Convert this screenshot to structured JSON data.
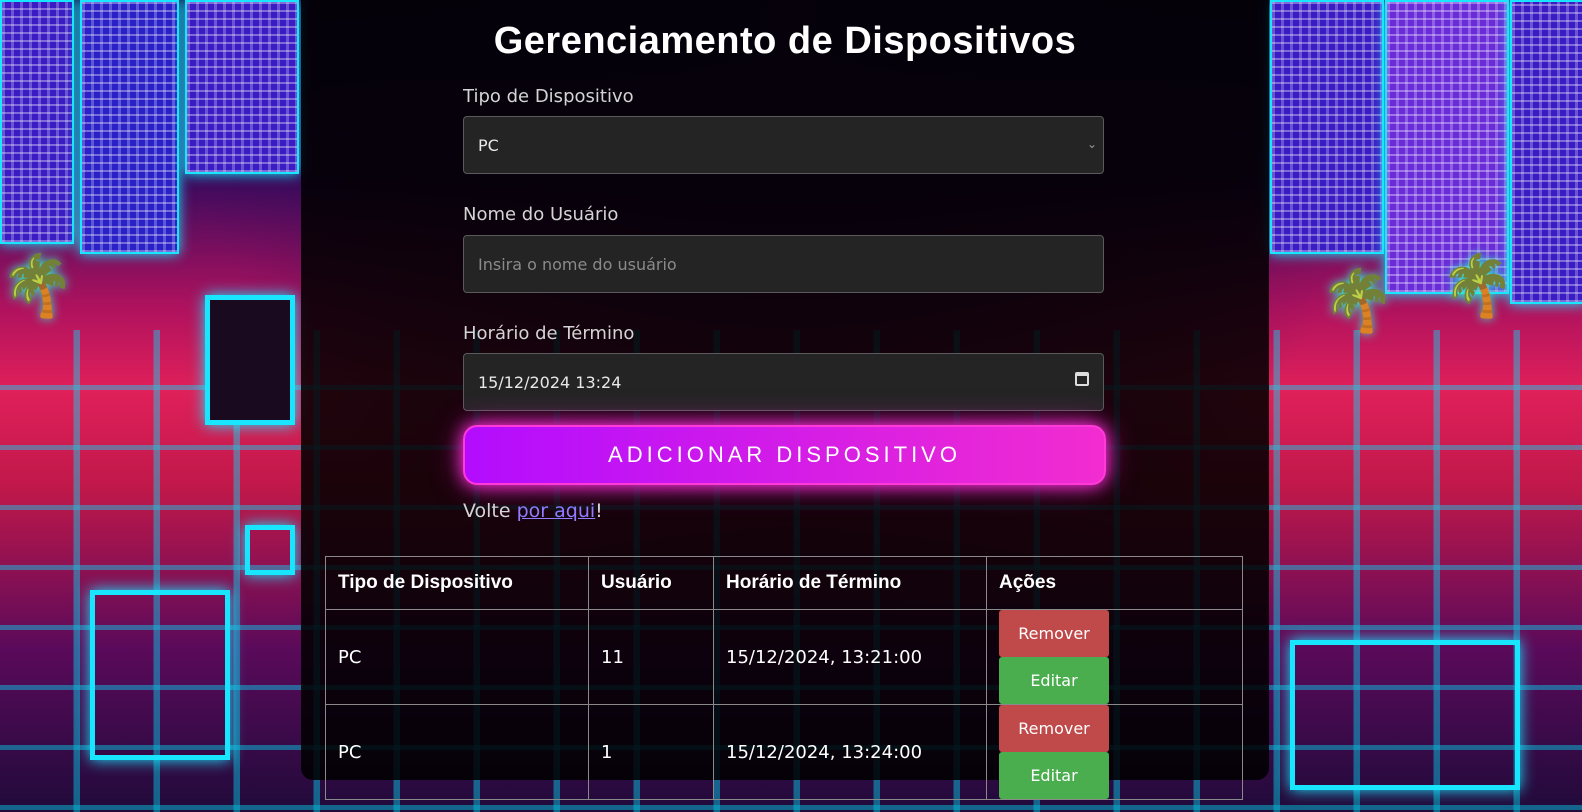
{
  "page": {
    "title": "Gerenciamento de Dispositivos"
  },
  "form": {
    "device_type_label": "Tipo de Dispositivo",
    "device_type_value": "PC",
    "user_name_label": "Nome do Usuário",
    "user_name_placeholder": "Insira o nome do usuário",
    "end_time_label": "Horário de Término",
    "end_time_value": "15/12/2024 13:24",
    "add_button": "ADICIONAR DISPOSITIVO",
    "back_prefix": "Volte ",
    "back_link": "por aqui",
    "back_suffix": "!"
  },
  "table": {
    "headers": [
      "Tipo de Dispositivo",
      "Usuário",
      "Horário de Término",
      "Ações"
    ],
    "rows": [
      {
        "type": "PC",
        "user": "11",
        "end": "15/12/2024, 13:21:00"
      },
      {
        "type": "PC",
        "user": "1",
        "end": "15/12/2024, 13:24:00"
      }
    ],
    "remove_label": "Remover",
    "edit_label": "Editar"
  },
  "colors": {
    "accent_gradient_start": "#b30cff",
    "accent_gradient_end": "#f22cd0",
    "remove": "#c0494a",
    "edit": "#4aad4e",
    "link": "#8f7cff"
  },
  "icons": {
    "select_chevron": "chevron-down-icon",
    "date_picker": "calendar-icon"
  }
}
